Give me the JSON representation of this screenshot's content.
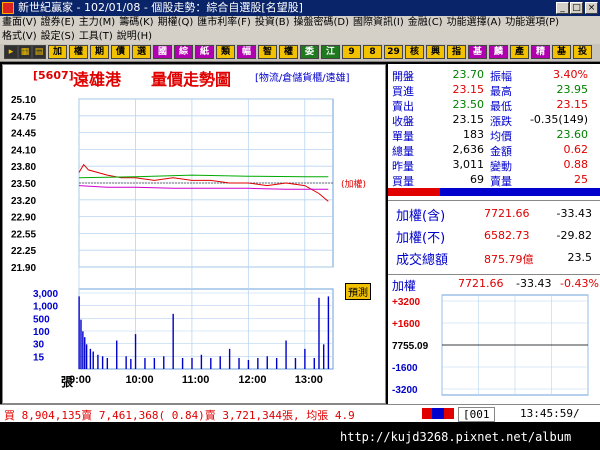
{
  "window": {
    "title": "新世紀贏家 - 102/01/08 - 個股走勢：綜合自選股[名望股]",
    "min_label": "_",
    "max_label": "□",
    "close_label": "×"
  },
  "menu1": [
    "畫面(V)",
    "證券(E)",
    "主力(M)",
    "籌碼(K)",
    "期權(Q)",
    "匯市利率(F)",
    "投資(B)",
    "操盤密碼(D)",
    "國際資訊(I)",
    "金融(C)",
    "功能選擇(A)",
    "功能選項(P)"
  ],
  "menu2": [
    "格式(V)",
    "設定(S)",
    "工具(T)",
    "說明(H)"
  ],
  "toolbar": {
    "buttons": [
      {
        "label": "加",
        "bg": "#f2c200",
        "fg": "#000"
      },
      {
        "label": "權",
        "bg": "#f2c200",
        "fg": "#000"
      },
      {
        "label": "期",
        "bg": "#f2c200",
        "fg": "#000"
      },
      {
        "label": "債",
        "bg": "#f2c200",
        "fg": "#000"
      },
      {
        "label": "選",
        "bg": "#f2c200",
        "fg": "#000"
      },
      {
        "label": "國",
        "bg": "#b000b0",
        "fg": "#fff"
      },
      {
        "label": "綜",
        "bg": "#b000b0",
        "fg": "#fff"
      },
      {
        "label": "紙",
        "bg": "#b000b0",
        "fg": "#fff"
      },
      {
        "label": "類",
        "bg": "#f2c200",
        "fg": "#000"
      },
      {
        "label": "幅",
        "bg": "#b000b0",
        "fg": "#fff"
      },
      {
        "label": "智",
        "bg": "#f2c200",
        "fg": "#000"
      },
      {
        "label": "權",
        "bg": "#f2c200",
        "fg": "#000"
      },
      {
        "label": "委",
        "bg": "#1f7a1f",
        "fg": "#fff"
      },
      {
        "label": "江",
        "bg": "#1f7a1f",
        "fg": "#fff"
      },
      {
        "label": "9",
        "bg": "#f2c200",
        "fg": "#000"
      },
      {
        "label": "8",
        "bg": "#f2c200",
        "fg": "#000"
      },
      {
        "label": "29",
        "bg": "#f2c200",
        "fg": "#000"
      },
      {
        "label": "核",
        "bg": "#f2c200",
        "fg": "#000"
      },
      {
        "label": "興",
        "bg": "#f2c200",
        "fg": "#000"
      },
      {
        "label": "指",
        "bg": "#f2c200",
        "fg": "#000"
      },
      {
        "label": "基",
        "bg": "#b000b0",
        "fg": "#fff"
      },
      {
        "label": "麟",
        "bg": "#b000b0",
        "fg": "#fff"
      },
      {
        "label": "產",
        "bg": "#f2c200",
        "fg": "#000"
      },
      {
        "label": "精",
        "bg": "#b000b0",
        "fg": "#fff"
      },
      {
        "label": "基",
        "bg": "#f2c200",
        "fg": "#000"
      },
      {
        "label": "投",
        "bg": "#f2c200",
        "fg": "#000"
      }
    ]
  },
  "stock": {
    "code": "[5607]",
    "name": "遠雄港",
    "chart_title": "量價走勢圖",
    "category": "[物流/倉儲貨櫃/遠雄]",
    "weighted_tag": "(加權)",
    "forecast_label": "預測",
    "vol_unit": "張"
  },
  "quote": {
    "left": [
      {
        "label": "開盤",
        "value": "23.70"
      },
      {
        "label": "買進",
        "value": "23.15"
      },
      {
        "label": "賣出",
        "value": "23.50"
      },
      {
        "label": "收盤",
        "value": "23.15"
      },
      {
        "label": "單量",
        "value": "183"
      },
      {
        "label": "總量",
        "value": "2,636"
      },
      {
        "label": "昨量",
        "value": "3,011"
      },
      {
        "label": "買量",
        "value": "69"
      }
    ],
    "right": [
      {
        "label": "振幅",
        "value": "3.40%"
      },
      {
        "label": "最高",
        "value": "23.95"
      },
      {
        "label": "最低",
        "value": "23.15"
      },
      {
        "label": "漲跌",
        "value": "-0.35(149)"
      },
      {
        "label": "均價",
        "value": "23.60"
      },
      {
        "label": "金額",
        "value": "0.62"
      },
      {
        "label": "變動",
        "value": "0.88"
      },
      {
        "label": "賣量",
        "value": "25"
      }
    ]
  },
  "index": {
    "rows": [
      {
        "label": "加權(含)",
        "value": "7721.66",
        "change": "-33.43"
      },
      {
        "label": "加權(不)",
        "value": "6582.73",
        "change": "-29.82"
      },
      {
        "label": "成交總額",
        "value": "875.79億",
        "change": "23.5"
      }
    ],
    "mini": {
      "label": "加權",
      "value": "7721.66",
      "change": "-33.43",
      "pct": "-0.43%",
      "yticks": [
        "+3200",
        "+1600",
        "7755.09",
        "-1600",
        "-3200"
      ]
    }
  },
  "status": {
    "text": "買 8,904,135賣 7,461,368( 0.84)賣 3,721,344張, 均張 4.9",
    "code_box": "[001",
    "time": "13:45:59/"
  },
  "url": "http://kujd3268.pixnet.net/album",
  "chart_data": {
    "type": "line",
    "title": "量價走勢圖",
    "x_ticks": [
      "9:00",
      "10:00",
      "11:00",
      "12:00",
      "13:00"
    ],
    "price_ticks": [
      "25.10",
      "24.75",
      "24.45",
      "24.10",
      "23.80",
      "23.50",
      "23.20",
      "22.90",
      "22.55",
      "22.25",
      "21.90"
    ],
    "volume_ticks": [
      "3,000",
      "1,000",
      "500",
      "100",
      "30",
      "15"
    ],
    "ylim": [
      21.9,
      25.1
    ],
    "ref_price": 23.5,
    "series": [
      {
        "x_min": [
          0,
          5,
          10,
          20,
          30,
          45,
          60,
          80,
          100,
          120,
          140,
          160,
          180,
          200,
          220,
          240,
          255,
          265
        ],
        "values": [
          23.7,
          23.85,
          23.75,
          23.7,
          23.65,
          23.6,
          23.6,
          23.55,
          23.6,
          23.55,
          23.55,
          23.5,
          23.5,
          23.45,
          23.5,
          23.45,
          23.3,
          23.15
        ],
        "color": "#e00000"
      },
      {
        "x_min": [
          0,
          30,
          60,
          100,
          140,
          180,
          220,
          265
        ],
        "values": [
          23.45,
          23.42,
          23.42,
          23.4,
          23.4,
          23.4,
          23.38,
          23.38
        ],
        "color": "#d000d0"
      },
      {
        "x_min": [
          0,
          60,
          120,
          180,
          240,
          265
        ],
        "values": [
          23.6,
          23.62,
          23.65,
          23.63,
          23.62,
          23.62
        ],
        "color": "#00aa00"
      }
    ],
    "volumes": {
      "x_min": [
        0,
        2,
        4,
        6,
        8,
        12,
        15,
        20,
        25,
        30,
        40,
        50,
        55,
        60,
        70,
        80,
        90,
        100,
        110,
        120,
        130,
        140,
        150,
        160,
        170,
        180,
        190,
        200,
        210,
        220,
        230,
        240,
        250,
        255,
        260,
        265
      ],
      "values": [
        2600,
        1200,
        700,
        500,
        300,
        200,
        150,
        100,
        80,
        60,
        400,
        80,
        50,
        600,
        60,
        60,
        80,
        1500,
        60,
        60,
        100,
        60,
        80,
        200,
        60,
        40,
        60,
        80,
        60,
        400,
        60,
        200,
        60,
        2500,
        300,
        2600
      ]
    }
  }
}
